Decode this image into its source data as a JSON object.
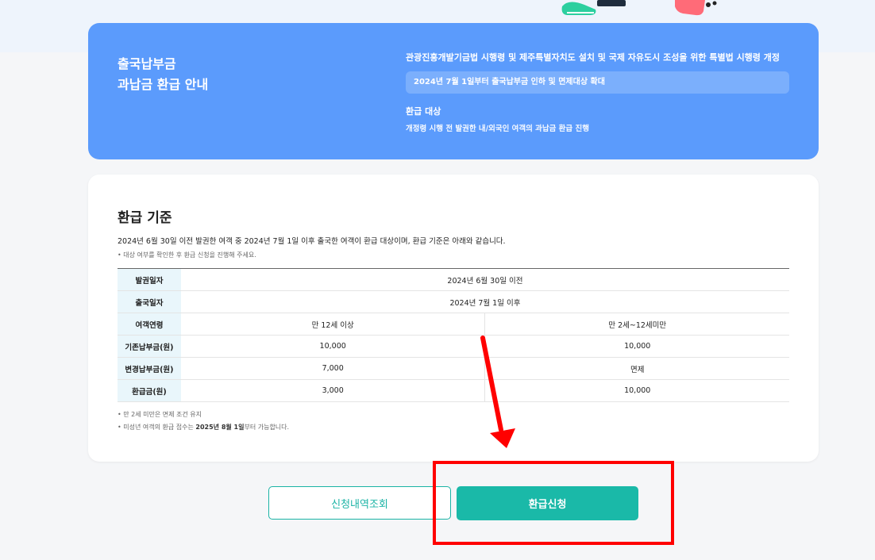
{
  "info": {
    "title_line1": "출국납부금",
    "title_line2": "과납금 환급 안내",
    "law": "관광진흥개발기금법 시행령 및 제주특별자치도 설치 및 국제 자유도시 조성을 위한 특별법 시행령 개정",
    "notice": "2024년 7월 1일부터 출국납부금 인하 및 면제대상 확대",
    "target_label": "환급 대상",
    "target_desc": "개정령 시행 전 발권한 내/외국인 여객의 과납금 환급 진행"
  },
  "criteria": {
    "title": "환급 기준",
    "desc": "2024년 6월 30일 이전 발권한 여객 중 2024년 7월 1일 이후 출국한 여객이 환급 대상이며, 환급 기준은 아래와 같습니다.",
    "note": "• 대상 여부를 확인한 후 환급 신청을 진행해 주세요.",
    "table": {
      "issue_date": {
        "label": "발권일자",
        "value": "2024년 6월 30일 이전"
      },
      "depart_date": {
        "label": "출국일자",
        "value": "2024년 7월 1일 이후"
      },
      "age": {
        "label": "여객연령",
        "adult": "만 12세 이상",
        "child": "만 2세~12세미만"
      },
      "old_fee": {
        "label": "기존납부금(원)",
        "adult": "10,000",
        "child": "10,000"
      },
      "new_fee": {
        "label": "변경납부금(원)",
        "adult": "7,000",
        "child": "면제"
      },
      "refund": {
        "label": "환급금(원)",
        "adult": "3,000",
        "child": "10,000"
      }
    },
    "foot_note1": "• 만 2세 미만은 면제 조건 유지",
    "foot_note2_pre": "• 미성년 여객의 환급 접수는 ",
    "foot_note2_bold": "2025년 8월 1일",
    "foot_note2_post": "부터 가능합니다."
  },
  "buttons": {
    "history": "신청내역조회",
    "refund": "환급신청"
  },
  "colors": {
    "info_card": "#5b9bfc",
    "accent": "#1ab9a8",
    "table_header": "#e9f6fb",
    "annotation": "#ff0000"
  }
}
